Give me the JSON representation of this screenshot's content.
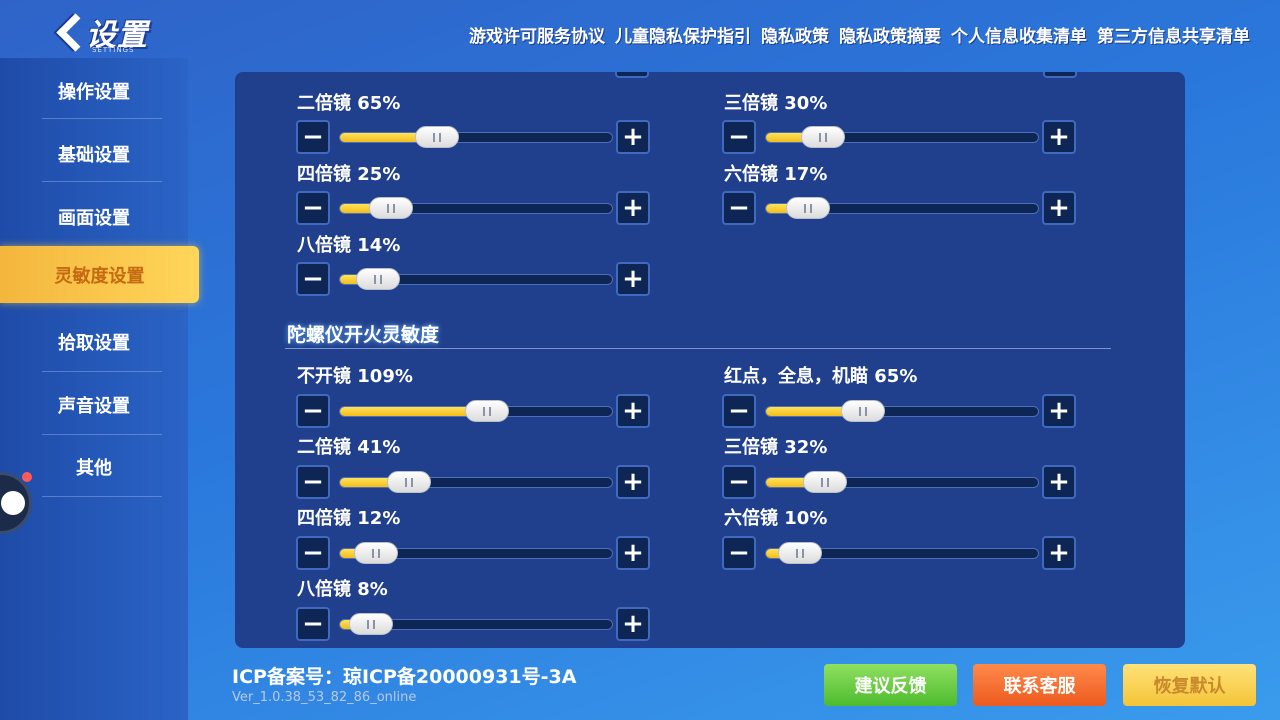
{
  "header": {
    "title": "设置",
    "subtitle": "SETTINGS",
    "links": [
      "游戏许可服务协议",
      "儿童隐私保护指引",
      "隐私政策",
      "隐私政策摘要",
      "个人信息收集清单",
      "第三方信息共享清单"
    ]
  },
  "sidebar": {
    "items": [
      {
        "label": "操作设置",
        "active": false
      },
      {
        "label": "基础设置",
        "active": false
      },
      {
        "label": "画面设置",
        "active": false
      },
      {
        "label": "灵敏度设置",
        "active": true
      },
      {
        "label": "拾取设置",
        "active": false
      },
      {
        "label": "声音设置",
        "active": false
      },
      {
        "label": "其他",
        "active": false
      }
    ]
  },
  "main": {
    "upper_rows": [
      {
        "label": "二倍镜 65%",
        "percent": 65
      },
      {
        "label": "三倍镜 30%",
        "percent": 30
      },
      {
        "label": "四倍镜 25%",
        "percent": 25
      },
      {
        "label": "六倍镜 17%",
        "percent": 17
      },
      {
        "label": "八倍镜 14%",
        "percent": 14
      }
    ],
    "section_title": "陀螺仪开火灵敏度",
    "gyro_rows": [
      {
        "label": "不开镜 109%",
        "percent": 109
      },
      {
        "label": "红点，全息，机瞄 65%",
        "percent": 65
      },
      {
        "label": "二倍镜 41%",
        "percent": 41
      },
      {
        "label": "三倍镜 32%",
        "percent": 32
      },
      {
        "label": "四倍镜 12%",
        "percent": 12
      },
      {
        "label": "六倍镜 10%",
        "percent": 10
      },
      {
        "label": "八倍镜 8%",
        "percent": 8
      }
    ],
    "minus_symbol": "−",
    "plus_symbol": "+"
  },
  "footer": {
    "icp": "ICP备案号：琼ICP备20000931号-3A",
    "version": "Ver_1.0.38_53_82_86_online",
    "feedback_label": "建议反馈",
    "support_label": "联系客服",
    "reset_label": "恢复默认"
  },
  "colors": {
    "active_tab": "#ffd65a",
    "slider_fill": "#f3bd1c",
    "feedback_button": "#4dbb2e",
    "support_button": "#ec5a1e",
    "reset_button": "#f4c437"
  }
}
